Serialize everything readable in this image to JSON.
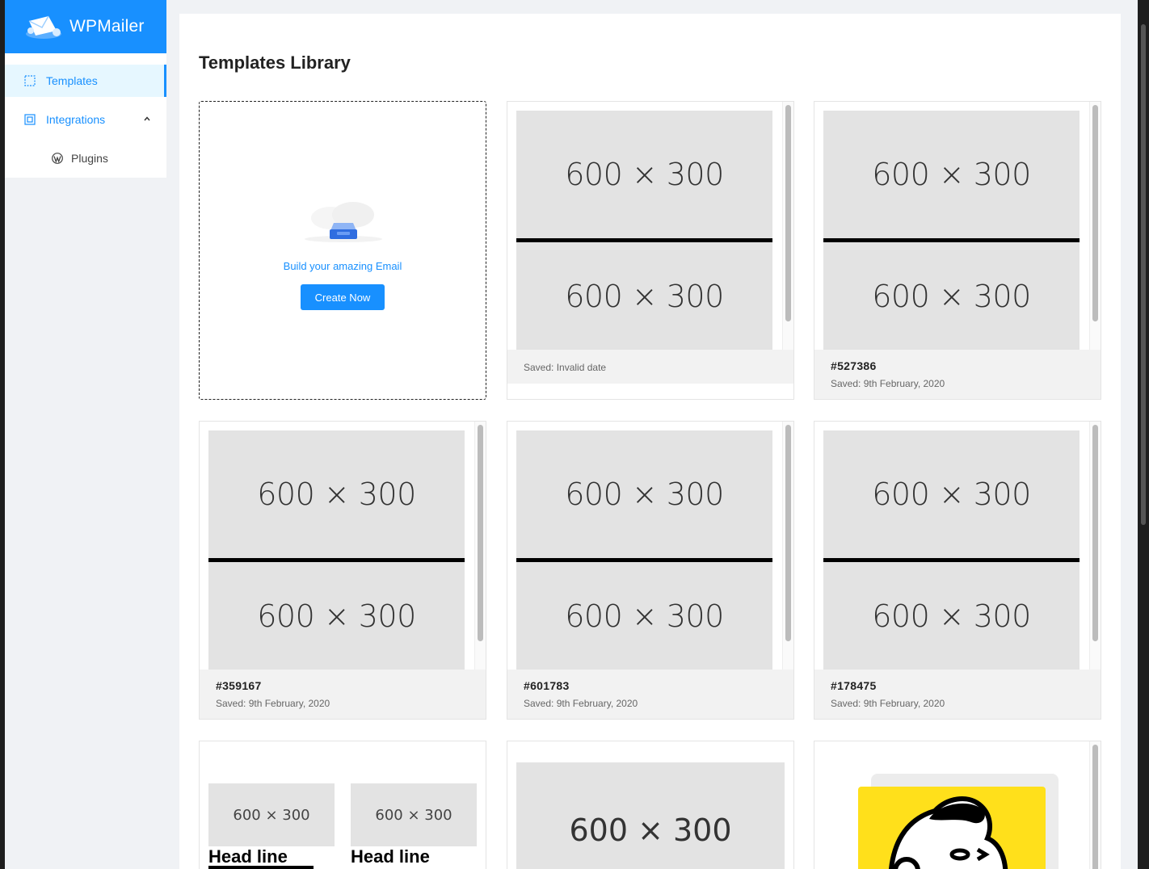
{
  "brand": {
    "name": "WPMailer"
  },
  "sidebar": {
    "items": [
      {
        "label": "Templates",
        "icon": "template-icon",
        "active": true
      },
      {
        "label": "Integrations",
        "icon": "integrations-icon",
        "expanded": true
      },
      {
        "label": "Plugins",
        "icon": "wordpress-icon"
      }
    ]
  },
  "main": {
    "title": "Templates Library",
    "create_card": {
      "text": "Build your amazing Email",
      "button": "Create Now"
    },
    "placeholder_text": "600 × 300",
    "templates": [
      {
        "id": "",
        "saved": "Saved: Invalid date"
      },
      {
        "id": "#527386",
        "saved": "Saved: 9th February, 2020"
      },
      {
        "id": "#359167",
        "saved": "Saved: 9th February, 2020"
      },
      {
        "id": "#601783",
        "saved": "Saved: 9th February, 2020"
      },
      {
        "id": "#178475",
        "saved": "Saved: 9th February, 2020"
      }
    ],
    "row3": {
      "headline": "Head line"
    }
  },
  "colors": {
    "accent": "#1890ff",
    "mailchimp": "#ffe01b"
  }
}
